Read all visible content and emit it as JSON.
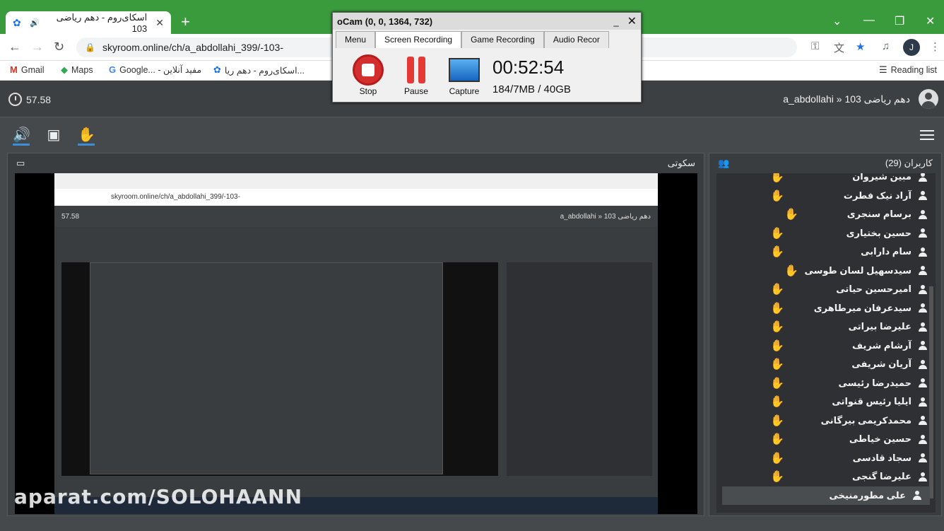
{
  "browser": {
    "tab_title": "اسکای‌روم - دهم ریاضی 103",
    "url": "skyroom.online/ch/a_abdollahi_399/-103-",
    "profile_initial": "J",
    "bookmarks": [
      "Gmail",
      "Maps",
      "Google... - مفید آنلاین",
      "اسکای‌روم - دهم ریا..."
    ],
    "reading_list": "Reading list"
  },
  "app": {
    "timer": "57.58",
    "room_title": "a_abdollahi » دهم ریاضی 103",
    "main_panel_title": "سکوتی",
    "users_title": "کاربران (29)"
  },
  "users": [
    {
      "name": "مبین شیروان",
      "hand": true
    },
    {
      "name": "آراد نیک فطرت",
      "hand": true
    },
    {
      "name": "برسام سنجری",
      "hand": true
    },
    {
      "name": "حسین بختیاری",
      "hand": true
    },
    {
      "name": "سام دارابی",
      "hand": true
    },
    {
      "name": "سیدسهیل لسان طوسی",
      "hand": true
    },
    {
      "name": "امیرحسین حیاتی",
      "hand": true
    },
    {
      "name": "سیدعرفان میرطاهری",
      "hand": true
    },
    {
      "name": "علیرضا بیراتی",
      "hand": true
    },
    {
      "name": "آرشام شریف",
      "hand": true
    },
    {
      "name": "آریان شریفی",
      "hand": true
    },
    {
      "name": "حمیدرضا رئیسی",
      "hand": true
    },
    {
      "name": "ایلیا رئیس قنواتی",
      "hand": true
    },
    {
      "name": "محمدکریمی بیرگانی",
      "hand": true
    },
    {
      "name": "حسین خیاطی",
      "hand": true
    },
    {
      "name": "سجاد قادسی",
      "hand": true
    },
    {
      "name": "علیرضا گنجی",
      "hand": true
    },
    {
      "name": "علی مطورمنیخی",
      "hand": false
    }
  ],
  "ocam": {
    "title": "oCam (0, 0, 1364, 732)",
    "tabs": [
      "Menu",
      "Screen Recording",
      "Game Recording",
      "Audio Recor"
    ],
    "stop": "Stop",
    "pause": "Pause",
    "capture": "Capture",
    "time": "00:52:54",
    "size": "184/7MB / 40GB"
  },
  "nested": {
    "url": "skyroom.online/ch/a_abdollahi_399/-103-",
    "timer": "57.58",
    "room": "a_abdollahi » دهم ریاضی 103"
  },
  "watermark": "aparat.com/SOLOHAANN"
}
